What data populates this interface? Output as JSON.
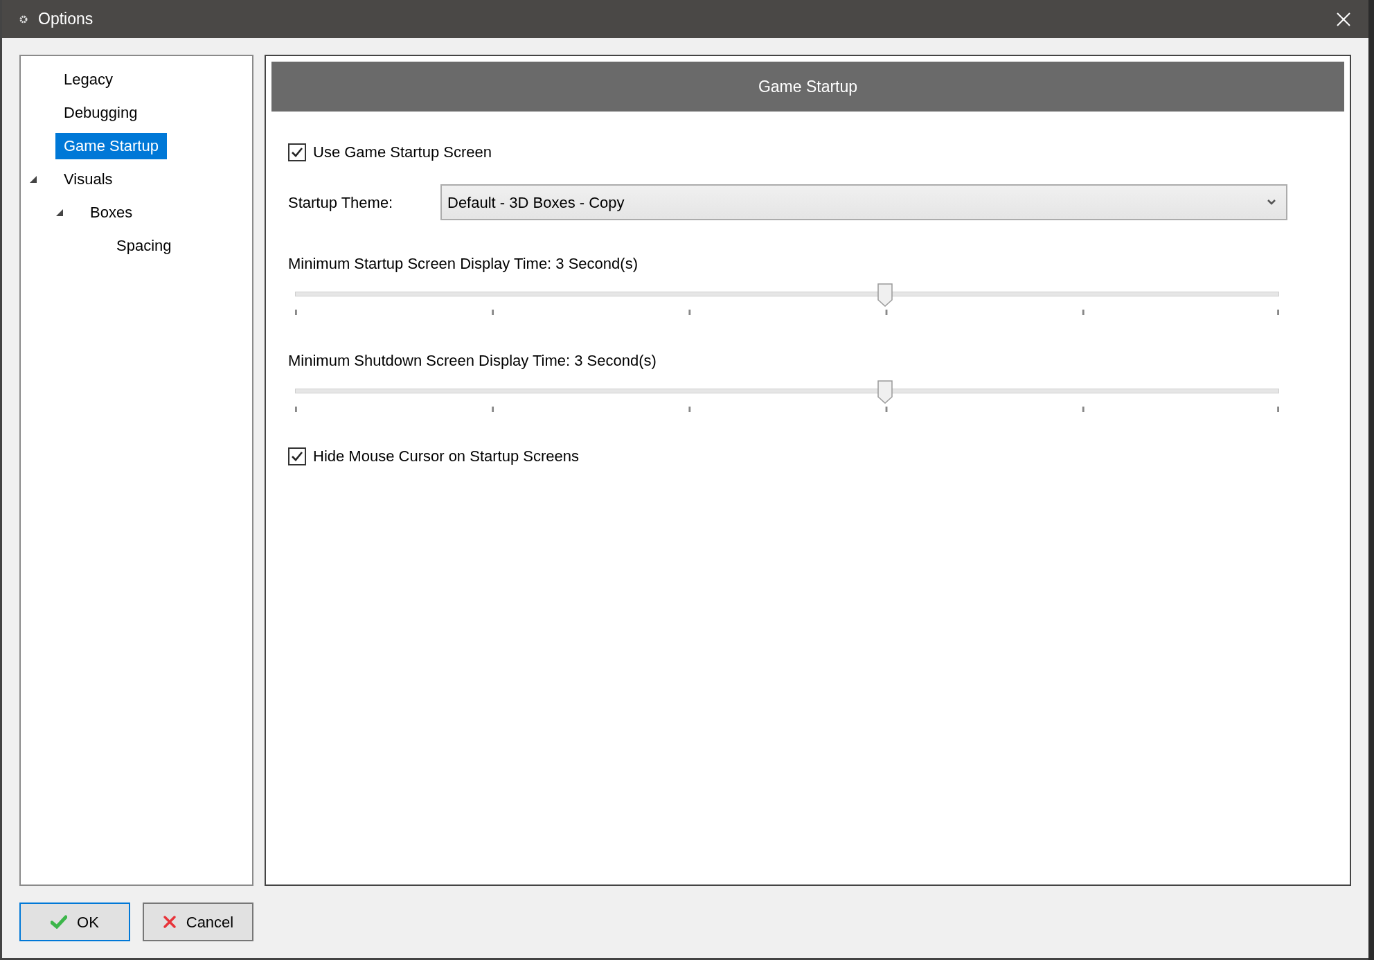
{
  "window": {
    "title": "Options"
  },
  "tree": [
    {
      "label": "Legacy",
      "selected": false
    },
    {
      "label": "Debugging",
      "selected": false
    },
    {
      "label": "Game Startup",
      "selected": true
    },
    {
      "label": "Visuals",
      "selected": false,
      "expanded": true,
      "children": [
        {
          "label": "Boxes",
          "selected": false,
          "expanded": true,
          "children": [
            {
              "label": "Spacing",
              "selected": false
            }
          ]
        }
      ]
    }
  ],
  "panel": {
    "header": "Game Startup",
    "use_startup_screen": {
      "label": "Use Game Startup Screen",
      "checked": true
    },
    "theme": {
      "label": "Startup Theme:",
      "value": "Default - 3D Boxes - Copy"
    },
    "sliders": [
      {
        "label": "Minimum Startup Screen Display Time: 3 Second(s)",
        "level": 0.6
      },
      {
        "label": "Minimum Shutdown Screen Display Time: 3 Second(s)",
        "level": 0.6
      }
    ],
    "hide_cursor": {
      "label": "Hide Mouse Cursor on Startup Screens",
      "checked": true
    }
  },
  "buttons": [
    {
      "label": "OK",
      "kind": "ok",
      "selected": true
    },
    {
      "label": "Cancel",
      "kind": "cancel",
      "selected": false
    }
  ]
}
